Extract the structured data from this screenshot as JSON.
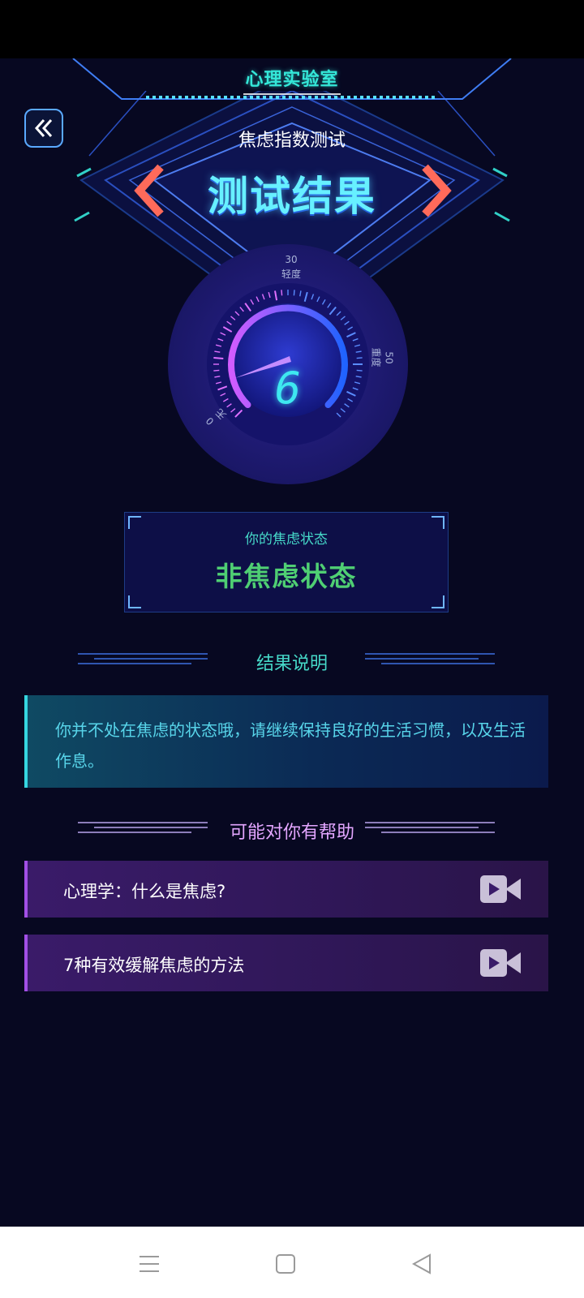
{
  "header": {
    "brand": "心理实验室",
    "test_name": "焦虑指数测试",
    "result_title": "测试结果"
  },
  "gauge": {
    "value": "6",
    "ticks": {
      "t30": "30",
      "light": "轻度",
      "t50": "50",
      "heavy": "重度",
      "t0": "0",
      "none": "无"
    },
    "colors": {
      "arc_start": "#d25cff",
      "arc_end": "#1f63ff",
      "value": "#3ee8f0"
    }
  },
  "status": {
    "label": "你的焦虑状态",
    "value": "非焦虑状态"
  },
  "explanation": {
    "title": "结果说明",
    "text": "你并不处在焦虑的状态哦，请继续保持良好的生活习惯，以及生活作息。"
  },
  "help": {
    "title": "可能对你有帮助",
    "items": [
      {
        "label": "心理学：什么是焦虑?",
        "icon": "video-icon"
      },
      {
        "label": "7种有效缓解焦虑的方法",
        "icon": "video-icon"
      }
    ]
  },
  "nav": {
    "icons": [
      "menu-icon",
      "home-icon",
      "back-icon"
    ]
  }
}
